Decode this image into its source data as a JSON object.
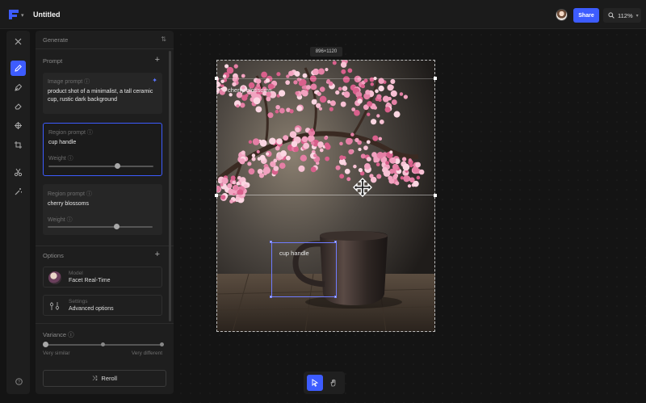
{
  "app": {
    "title": "Untitled"
  },
  "topbar": {
    "share_label": "Share",
    "zoom_label": "112%"
  },
  "panel": {
    "header": "Generate",
    "prompt_section": "Prompt",
    "image_prompt": {
      "label": "Image prompt",
      "text": "product shot of a minimalist, a tall ceramic cup, rustic dark background"
    },
    "regions": [
      {
        "label": "Region prompt",
        "text": "cup handle",
        "weight_label": "Weight",
        "weight": 0.66
      },
      {
        "label": "Region prompt",
        "text": "cherry blossoms",
        "weight_label": "Weight",
        "weight": 0.66
      }
    ],
    "options_section": "Options",
    "model": {
      "small": "Model",
      "main": "Facet Real-Time"
    },
    "settings": {
      "small": "Settings",
      "main": "Advanced options"
    },
    "variance": {
      "label": "Variance",
      "left": "Very similar",
      "right": "Very different",
      "value": 0.0
    },
    "reroll_label": "Reroll"
  },
  "canvas": {
    "size_badge": "896×1120",
    "region_labels": [
      "cherry blossoms",
      "cup handle"
    ]
  },
  "colors": {
    "accent": "#3d5cff",
    "panel": "#1e1e1e",
    "background": "#141414"
  }
}
